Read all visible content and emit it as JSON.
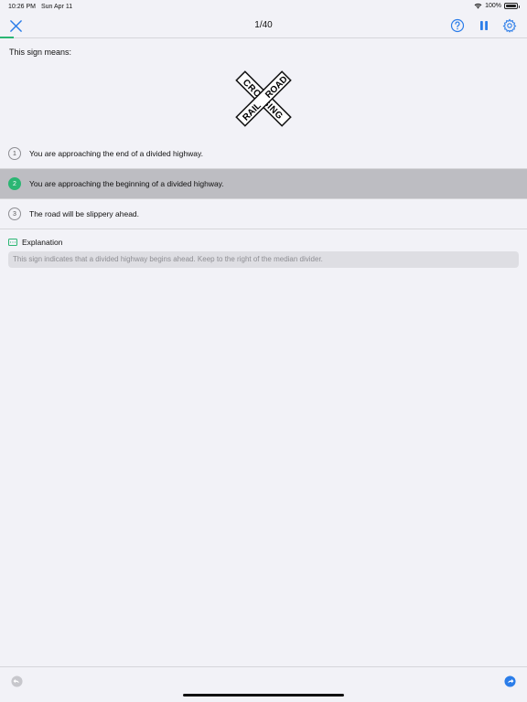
{
  "status_bar": {
    "time": "10:26 PM",
    "date": "Sun Apr 11",
    "battery": "100%"
  },
  "nav": {
    "counter": "1/40",
    "accent": "#2b7de9"
  },
  "question": {
    "prompt": "This sign means:"
  },
  "sign": {
    "top_word": "RAIL",
    "top_word_right": "ROAD",
    "cross_word": "CROSSING"
  },
  "answers": [
    {
      "number": "1",
      "text": "You are approaching the end of a divided highway.",
      "selected": false
    },
    {
      "number": "2",
      "text": "You are approaching the beginning of a divided highway.",
      "selected": true
    },
    {
      "number": "3",
      "text": "The road will be slippery ahead.",
      "selected": false
    }
  ],
  "explanation": {
    "title": "Explanation",
    "text": "This sign indicates that a divided highway begins ahead. Keep to the right of the median divider."
  },
  "colors": {
    "correct": "#2bb673",
    "selected_row": "#bdbdc2",
    "accent": "#2b7de9"
  },
  "icons": [
    "close-icon",
    "help-icon",
    "pause-icon",
    "gear-icon",
    "back-icon",
    "forward-icon",
    "explanation-icon",
    "wifi-icon",
    "battery-icon"
  ]
}
